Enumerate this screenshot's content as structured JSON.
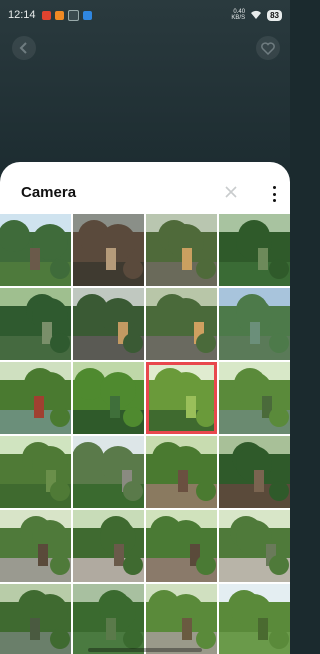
{
  "status_bar": {
    "time": "12:14",
    "network_speed": "0.40",
    "network_unit": "KB/S",
    "battery": "83"
  },
  "sheet": {
    "title": "Camera"
  },
  "photos": [
    {
      "desc": "forest-building",
      "sky": "#cfe3ef",
      "top": "#3f6b3a",
      "bottom": "#4e7a3c",
      "accent": "#6a5a4a"
    },
    {
      "desc": "wooden-structure",
      "sky": "#8a8f88",
      "top": "#5a4a3c",
      "bottom": "#3f3a30",
      "accent": "#b59b7a"
    },
    {
      "desc": "stone-wall-bamboo",
      "sky": "#b9c6b0",
      "top": "#4f6a3a",
      "bottom": "#6a6a5a",
      "accent": "#caa060"
    },
    {
      "desc": "bamboo-forest",
      "sky": "#a8c3a0",
      "top": "#2f5a2a",
      "bottom": "#3a6b35",
      "accent": "#6d8a5a"
    },
    {
      "desc": "forest-trail",
      "sky": "#9fbf8f",
      "top": "#2f5a2f",
      "bottom": "#456a40",
      "accent": "#7a8f6a"
    },
    {
      "desc": "stone-wall-windows",
      "sky": "#c0c8c0",
      "top": "#3a5a34",
      "bottom": "#5a5a54",
      "accent": "#c39a62"
    },
    {
      "desc": "stone-wall-lanterns",
      "sky": "#b8c6a8",
      "top": "#4a6a3a",
      "bottom": "#6a6a60",
      "accent": "#d0a060"
    },
    {
      "desc": "lake-mountain",
      "sky": "#a8c4dc",
      "top": "#4d7a4a",
      "bottom": "#5a7a58",
      "accent": "#6b8f7a"
    },
    {
      "desc": "river-cabin",
      "sky": "#cfe0c0",
      "top": "#4a7a30",
      "bottom": "#6b8f7a",
      "accent": "#a04030"
    },
    {
      "desc": "river-green-trees",
      "sky": "#bfd8a8",
      "top": "#4f8a2f",
      "bottom": "#2f5a2a",
      "accent": "#3f6f3a"
    },
    {
      "desc": "sunlit-tree",
      "sky": "#e0ecd0",
      "top": "#6a9a3a",
      "bottom": "#3f6a2f",
      "accent": "#9abf5a",
      "selected": true
    },
    {
      "desc": "riverbank",
      "sky": "#d8e8c8",
      "top": "#5a8a3a",
      "bottom": "#6a8a70",
      "accent": "#4a6a3a"
    },
    {
      "desc": "lush-forest",
      "sky": "#d0e4c0",
      "top": "#4f7a36",
      "bottom": "#3f6a2f",
      "accent": "#6a8f4a"
    },
    {
      "desc": "pavilion-trees",
      "sky": "#dde6e8",
      "top": "#5a7a4a",
      "bottom": "#3a6a2f",
      "accent": "#8a8a80"
    },
    {
      "desc": "path-railing",
      "sky": "#c8dcb0",
      "top": "#4a7a30",
      "bottom": "#8a7a60",
      "accent": "#6a5040"
    },
    {
      "desc": "boardwalk-forest",
      "sky": "#a8c098",
      "top": "#2f5a2a",
      "bottom": "#5a4a3a",
      "accent": "#7a6450"
    },
    {
      "desc": "paved-path-trees",
      "sky": "#d8e4c8",
      "top": "#4f7a3a",
      "bottom": "#9a9a90",
      "accent": "#5a4a3a"
    },
    {
      "desc": "forest-walkway",
      "sky": "#c8dcb8",
      "top": "#3f6a30",
      "bottom": "#b0aaa0",
      "accent": "#6a5a4a"
    },
    {
      "desc": "stairs-greenery",
      "sky": "#d0e2bc",
      "top": "#4a7a34",
      "bottom": "#8a7a6a",
      "accent": "#5a4a3a"
    },
    {
      "desc": "park-pathway",
      "sky": "#d8e6c8",
      "top": "#4f7a3a",
      "bottom": "#b8b4a8",
      "accent": "#6a7a5a"
    },
    {
      "desc": "pond-trees",
      "sky": "#b8cca8",
      "top": "#3f6a30",
      "bottom": "#6a7f6a",
      "accent": "#4a5a40"
    },
    {
      "desc": "bamboo-grove",
      "sky": "#a8c0a0",
      "top": "#3a6a2f",
      "bottom": "#4a7a40",
      "accent": "#5a7a4a"
    },
    {
      "desc": "garden-path",
      "sky": "#d0e0c0",
      "top": "#5a8a3a",
      "bottom": "#9a9a8a",
      "accent": "#6a5a40"
    },
    {
      "desc": "tall-tree-sky",
      "sky": "#e4eef2",
      "top": "#5a8a3a",
      "bottom": "#6a9a4a",
      "accent": "#4a6a30"
    }
  ]
}
